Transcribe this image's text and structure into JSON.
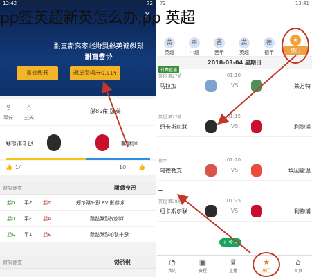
{
  "overlay_title": "pp签英超新英怎么办,pp 英超",
  "left": {
    "status_time": "13:42",
    "status_right": "72",
    "hero": {
      "line1": "该场新英雄提供独家高清直播",
      "line2": "付费直播",
      "btn_open_vip": "开通会员",
      "btn_buy_single": "¥12.0元购买单场"
    },
    "info": {
      "share": "分享",
      "follow": "关注",
      "match_title": "英超 第28轮"
    },
    "match": {
      "home": "利物浦",
      "away": "纽卡斯尔联"
    },
    "thumbs": {
      "left": "14",
      "right": "10"
    },
    "history": {
      "title": "历史数据",
      "more": "查看详情",
      "rows": [
        {
          "l": "0胜",
          "m": "3平",
          "r": "2胜",
          "n": "利物浦 VS 纽卡斯尔联"
        },
        {
          "l": "0胜",
          "m": "3平",
          "r": "4胜",
          "n": "利物浦近期战绩"
        },
        {
          "l": "2胜",
          "m": "1平",
          "r": "3胜",
          "n": "纽卡斯尔近期战绩"
        }
      ]
    },
    "ranking": {
      "title": "排行榜",
      "more": "查看详情"
    }
  },
  "right": {
    "status_left": "72",
    "status_right": "13:41",
    "leagues": [
      {
        "name": "英超",
        "logo": "英"
      },
      {
        "name": "中超",
        "logo": "中"
      },
      {
        "name": "西甲",
        "logo": "西"
      },
      {
        "name": "英超",
        "logo": "英"
      },
      {
        "name": "德甲",
        "logo": "德"
      },
      {
        "name": "热门",
        "logo": "★"
      }
    ],
    "date": "2018-03-04 星期日",
    "matches": [
      {
        "badge": "付费直播",
        "league": "英超 第27轮",
        "time": "01:10",
        "home": "马拉加",
        "away": "莱万特"
      },
      {
        "badge": "",
        "league": "英超 第27轮",
        "time": "01:15",
        "home": "纽卡斯尔联",
        "away": "利物浦"
      },
      {
        "badge": "",
        "league": "荷甲",
        "time": "01:20",
        "home": "乌德勒支",
        "away": "埃因霍温"
      },
      {
        "badge": "",
        "league": "英超 第28轮",
        "time": "01:25",
        "home": "纽卡斯尔联",
        "away": "利物浦"
      }
    ],
    "tooltip": "+ 今天",
    "tabs": [
      {
        "label": "我的",
        "icon": "user"
      },
      {
        "label": "赛程",
        "icon": "calendar"
      },
      {
        "label": "直播",
        "icon": "trophy"
      },
      {
        "label": "热门",
        "icon": "star"
      },
      {
        "label": "首页",
        "icon": "home"
      }
    ]
  }
}
